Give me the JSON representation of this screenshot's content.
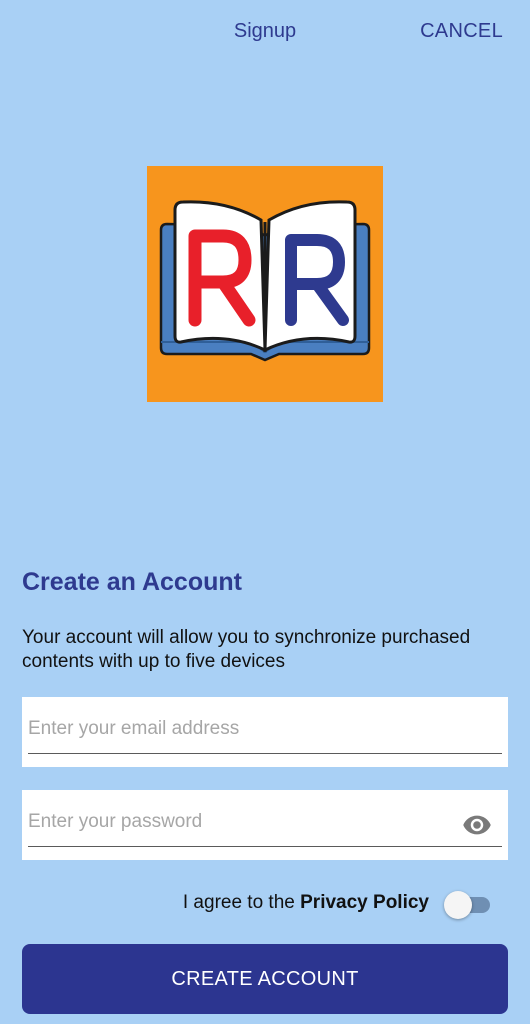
{
  "appbar": {
    "title": "Signup",
    "cancel_label": "CANCEL"
  },
  "logo": {
    "icon": "open-book-rr-logo",
    "left_letter": "R",
    "right_letter": "R",
    "colors": {
      "background": "#f7951d",
      "left_letter": "#e8202a",
      "right_letter": "#2e3a8f",
      "book_cover": "#4a7fc1"
    }
  },
  "form": {
    "heading": "Create an Account",
    "description": "Your account will allow you to synchronize purchased contents with up to five devices",
    "email": {
      "value": "",
      "placeholder": "Enter your email address"
    },
    "password": {
      "value": "",
      "placeholder": "Enter your password",
      "toggle_icon": "eye-icon"
    },
    "agree_prefix": "I agree to the ",
    "agree_link": "Privacy Policy",
    "agree_toggle_on": false,
    "submit_label": "CREATE ACCOUNT"
  },
  "colors": {
    "background": "#a9d0f5",
    "accent": "#2e3a8f",
    "button": "#2c3590"
  }
}
